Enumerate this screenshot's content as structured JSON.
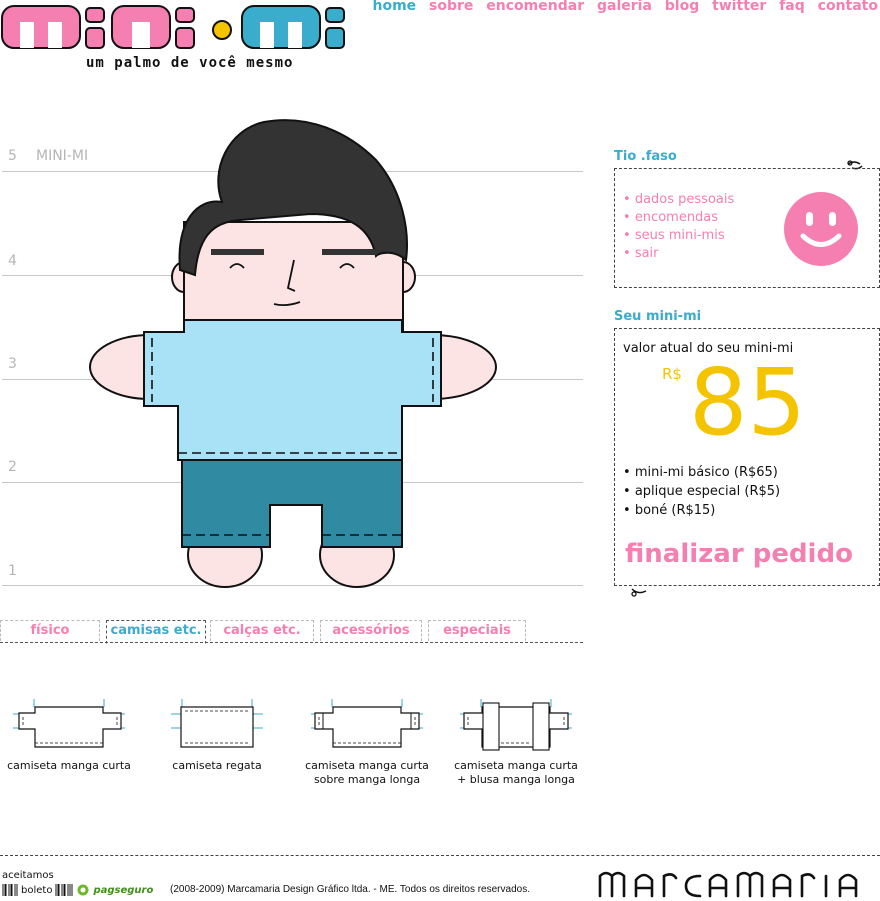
{
  "brand": {
    "logo_text": "mini-mi",
    "tagline": "um palmo de você mesmo",
    "colors": {
      "pink": "#f57fb0",
      "blue": "#3aaccc",
      "yellow": "#f5c400"
    }
  },
  "nav": [
    {
      "label": "home",
      "active": true
    },
    {
      "label": "sobre"
    },
    {
      "label": "encomendar"
    },
    {
      "label": "galeria"
    },
    {
      "label": "blog"
    },
    {
      "label": "twitter"
    },
    {
      "label": "faq"
    },
    {
      "label": "contato"
    }
  ],
  "ruler": {
    "name": "MINI-MI",
    "marks": [
      "5",
      "4",
      "3",
      "2",
      "1"
    ]
  },
  "tabs": [
    {
      "label": "físico"
    },
    {
      "label": "camisas etc.",
      "active": true
    },
    {
      "label": "calças etc."
    },
    {
      "label": "acessórios"
    },
    {
      "label": "especiais"
    }
  ],
  "products": [
    {
      "line1": "camiseta manga curta",
      "line2": ""
    },
    {
      "line1": "camiseta regata",
      "line2": ""
    },
    {
      "line1": "camiseta manga curta",
      "line2": "sobre manga longa"
    },
    {
      "line1": "camiseta manga curta",
      "line2": "+ blusa manga longa"
    }
  ],
  "user_panel": {
    "title": "Tio .faso",
    "links": [
      "dados pessoais",
      "encomendas",
      "seus mini-mis",
      "sair"
    ],
    "avatar": "smiley-icon"
  },
  "price_panel": {
    "title": "Seu mini-mi",
    "label": "valor atual do seu mini-mi",
    "currency": "R$",
    "value": "85",
    "items": [
      "mini-mi básico (R$65)",
      "aplique especial (R$5)",
      "boné (R$15)"
    ],
    "finalize": "finalizar pedido"
  },
  "footer": {
    "accept_label": "aceitamos",
    "boleto": "boleto",
    "pagseguro": "pagseguro",
    "copyright": "(2008-2009) Marcamaria Design Gráfico ltda. - ME. Todos os direitos reservados.",
    "maker": "marcamaria"
  }
}
